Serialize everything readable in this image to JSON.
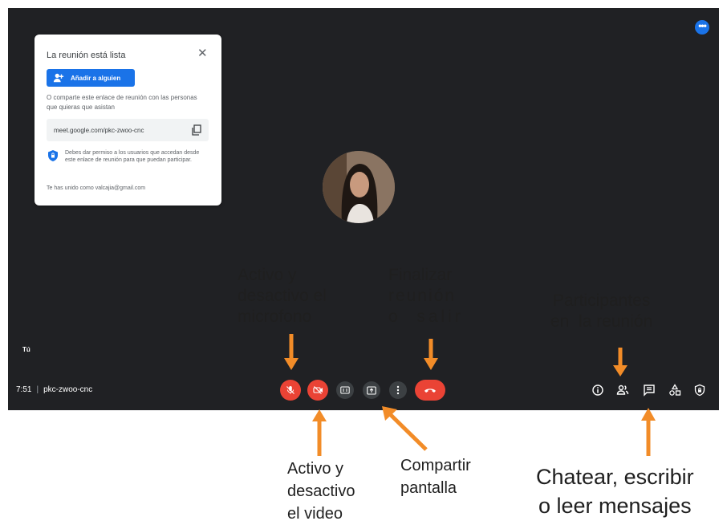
{
  "card": {
    "title": "La reunión está lista",
    "close_symbol": "✕",
    "add_button_label": "Añadir a alguien",
    "share_text": "O comparte este enlace de reunión con las personas que quieras que asistan",
    "link": "meet.google.com/pkc-zwoo-cnc",
    "permission_text": "Debes dar permiso a los usuarios que accedan desde este enlace de reunión para que puedan participar.",
    "joined_text": "Te has unido como valcajia@gmail.com"
  },
  "self_label": "Tú",
  "meeting": {
    "time": "7:51",
    "separator": "|",
    "code": "pkc-zwoo-cnc"
  },
  "more_symbol": "•••",
  "icons": {
    "mic": "mic-off-icon",
    "camera": "camera-off-icon",
    "captions": "captions-icon",
    "present": "present-screen-icon",
    "more": "more-vert-icon",
    "end_call": "end-call-icon",
    "info": "info-icon",
    "people": "people-icon",
    "chat": "chat-icon",
    "activities": "activities-icon",
    "host_controls": "host-controls-icon",
    "copy": "copy-icon",
    "shield": "shield-icon",
    "add_person": "add-person-icon"
  },
  "colors": {
    "meet_bg": "#202124",
    "red": "#ea4335",
    "blue": "#1a73e8",
    "arrow": "#f28c28"
  },
  "annotations": {
    "mic": [
      "Activo y",
      "desactivo el",
      "microfono"
    ],
    "end": [
      "Finalizar",
      "reunión",
      "o  salir"
    ],
    "participants": [
      "Participantes",
      "en  la reunión"
    ],
    "video": [
      "Activo y",
      "desactivo",
      "el video"
    ],
    "share": [
      "Compartir",
      "pantalla"
    ],
    "chat": [
      "Chatear, escribir",
      "o leer mensajes"
    ]
  }
}
